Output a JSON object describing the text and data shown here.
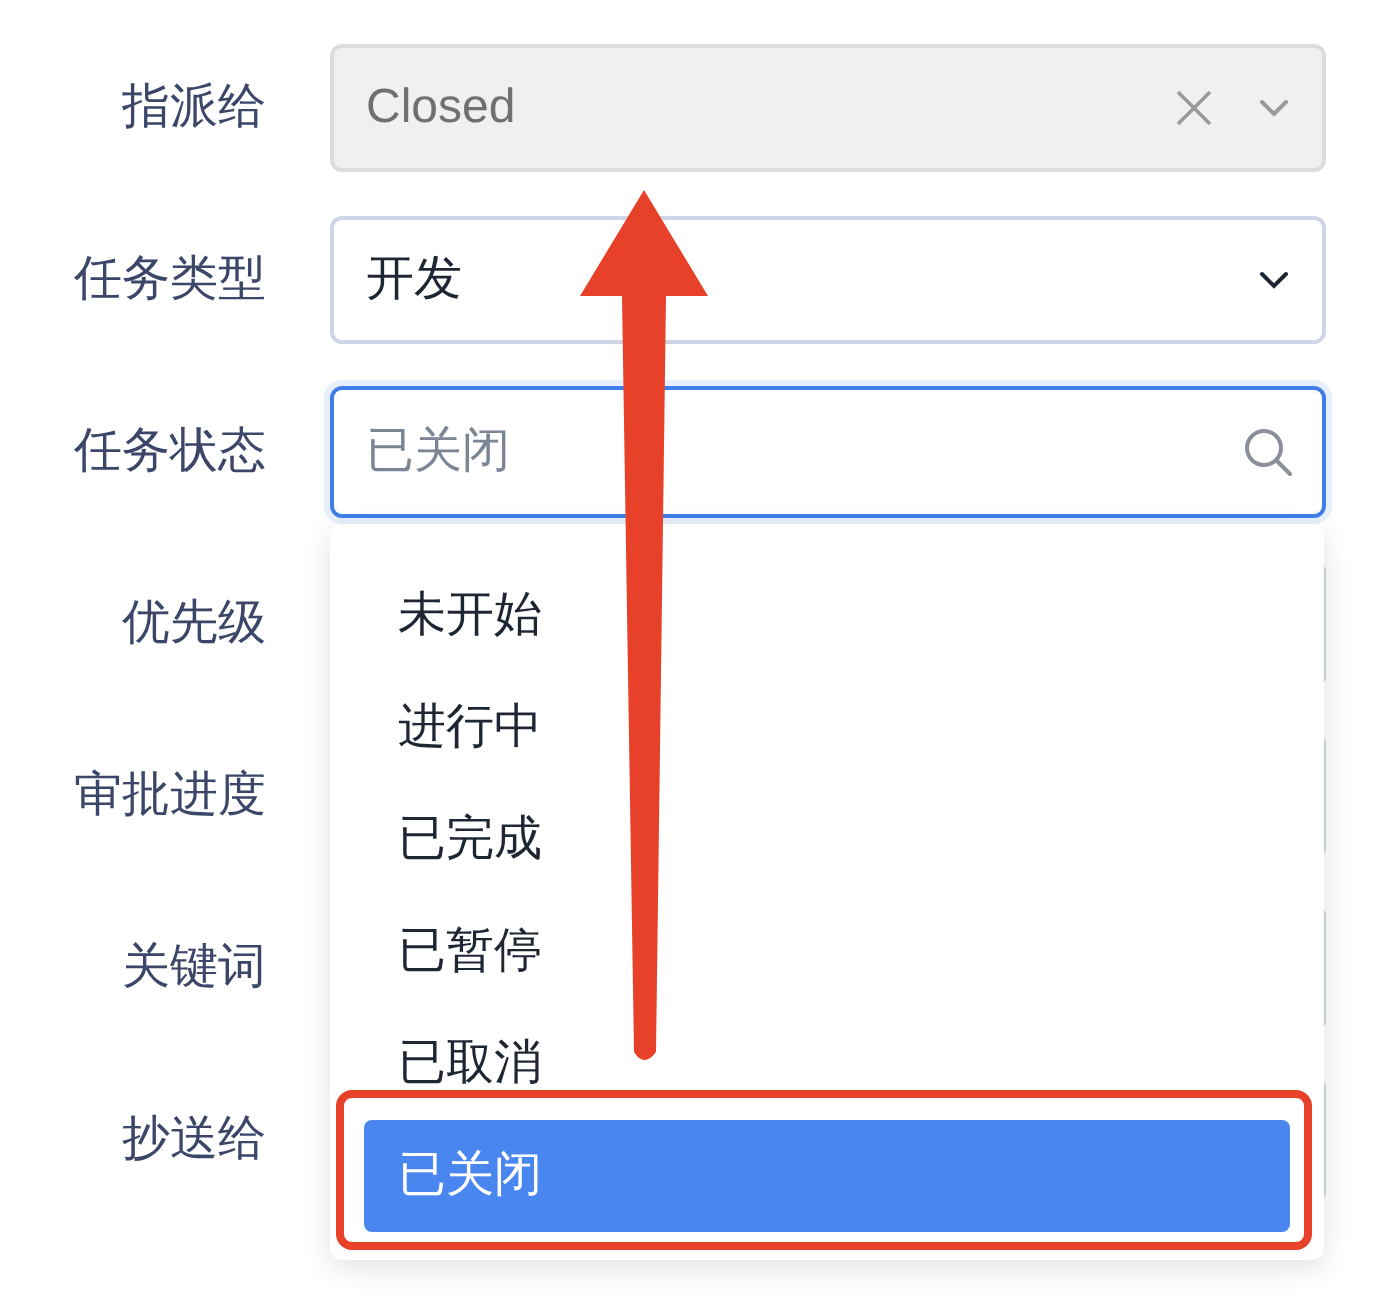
{
  "form": {
    "fields": [
      {
        "label": "指派给",
        "kind": "select",
        "value": "Closed",
        "disabled": true,
        "clearable": true
      },
      {
        "label": "任务类型",
        "kind": "select",
        "value": "开发",
        "disabled": false,
        "clearable": false
      },
      {
        "label": "任务状态",
        "kind": "search",
        "placeholder": "已关闭",
        "focused": true
      },
      {
        "label": "优先级",
        "kind": "select"
      },
      {
        "label": "审批进度",
        "kind": "select"
      },
      {
        "label": "关键词",
        "kind": "select"
      },
      {
        "label": "抄送给",
        "kind": "select"
      }
    ]
  },
  "dropdown": {
    "options": [
      {
        "label": "未开始",
        "selected": false
      },
      {
        "label": "进行中",
        "selected": false
      },
      {
        "label": "已完成",
        "selected": false
      },
      {
        "label": "已暂停",
        "selected": false
      },
      {
        "label": "已取消",
        "selected": false
      },
      {
        "label": "已关闭",
        "selected": true
      }
    ]
  },
  "annotations": {
    "arrow": true,
    "highlight_box": true
  }
}
